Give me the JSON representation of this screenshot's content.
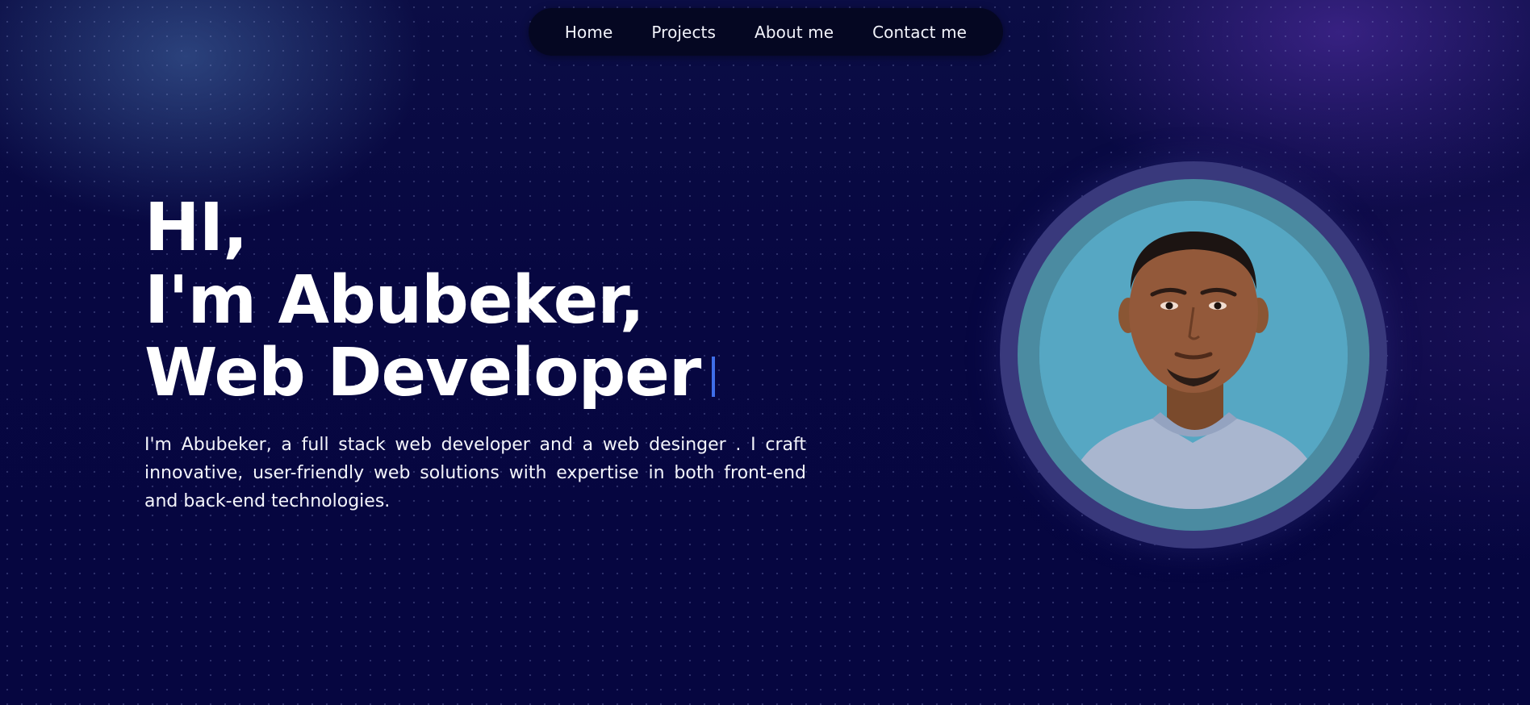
{
  "nav": {
    "items": [
      {
        "label": "Home"
      },
      {
        "label": "Projects"
      },
      {
        "label": "About me"
      },
      {
        "label": "Contact me"
      }
    ]
  },
  "hero": {
    "greeting": "HI,",
    "name_line": "I'm Abubeker,",
    "role_line": "Web Developer",
    "intro": "I'm Abubeker, a full stack web developer and a web desinger . I craft innovative, user-friendly web solutions with expertise in both front-end and back-end technologies."
  },
  "colors": {
    "background": "#070741",
    "nav_background": "#050722",
    "cursor_accent": "#3f6ee8",
    "ring_outer": "#39397c",
    "ring_mid": "#4b8ba1",
    "photo_background": "#56a7c3"
  },
  "profile_photo": {
    "icon": "portrait-photo"
  }
}
